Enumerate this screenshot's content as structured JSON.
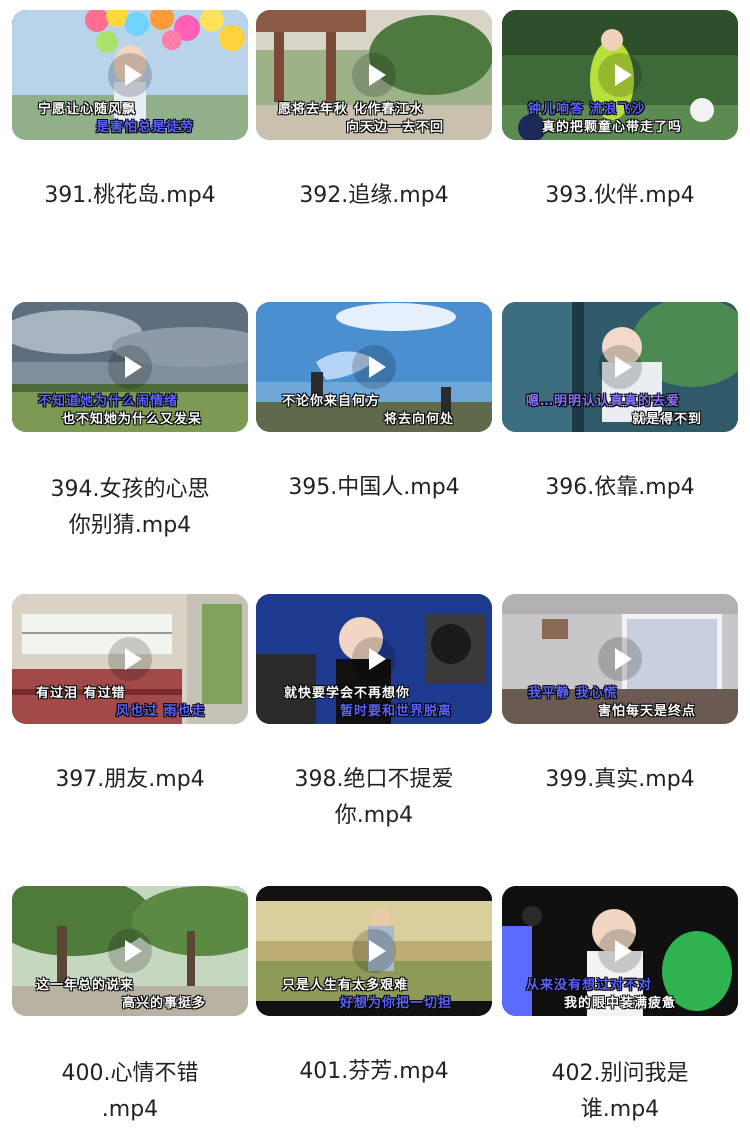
{
  "videos": [
    {
      "title": "391.桃花岛.mp4",
      "cap1": "宁愿让心随风飘",
      "cap2": "是害怕总是徒劳"
    },
    {
      "title": "392.追缘.mp4",
      "cap1": "愿将去年秋 化作春江水",
      "cap2": "向天边一去不回"
    },
    {
      "title": "393.伙伴.mp4",
      "cap1": "钟儿响答 流浪飞沙",
      "cap2": "真的把颗童心带走了吗"
    },
    {
      "title": "394.女孩的心思你别猜.mp4",
      "cap1": "不知道她为什么闹情绪",
      "cap2": "也不知她为什么又发呆"
    },
    {
      "title": "395.中国人.mp4",
      "cap1": "不论你来自何方",
      "cap2": "将去向何处"
    },
    {
      "title": "396.依靠.mp4",
      "cap1": "嗯…明明认认真真的去爱",
      "cap2": "就是得不到"
    },
    {
      "title": "397.朋友.mp4",
      "cap1": "有过泪 有过错",
      "cap2": "风也过 雨也走"
    },
    {
      "title": "398.绝口不提爱你.mp4",
      "cap1": "就快要学会不再想你",
      "cap2": "暂时要和世界脱离"
    },
    {
      "title": "399.真实.mp4",
      "cap1": "我平静 我心慌",
      "cap2": "害怕每天是终点"
    },
    {
      "title": "400.心情不错.mp4",
      "cap1": "这一年总的说来",
      "cap2": "高兴的事挺多"
    },
    {
      "title": "401.芬芳.mp4",
      "cap1": "只是人生有太多艰难",
      "cap2": "好想为你把一切担"
    },
    {
      "title": "402.别问我是谁.mp4",
      "cap1": "从来没有想过对不对",
      "cap2": "我的眼中装满疲惫"
    }
  ],
  "icons": {
    "play": "play-icon",
    "select": "select-circle-icon"
  }
}
